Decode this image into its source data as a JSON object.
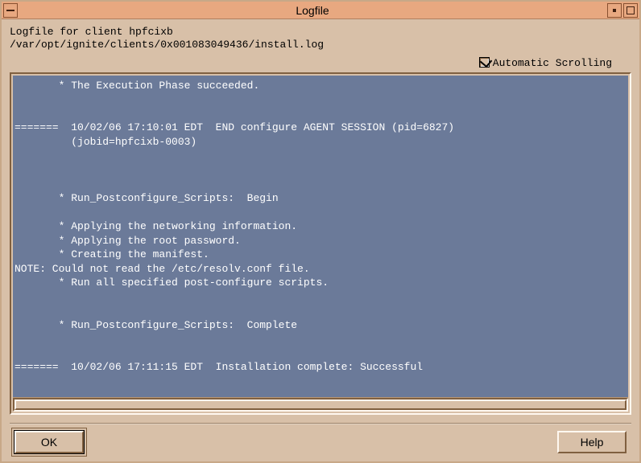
{
  "window": {
    "title": "Logfile"
  },
  "header": {
    "line1": "Logfile for client hpfcixb",
    "line2": "/var/opt/ignite/clients/0x001083049436/install.log"
  },
  "autoscroll": {
    "label": "Automatic Scrolling",
    "checked": true
  },
  "log": {
    "text": "       * The Execution Phase succeeded.\n\n\n=======  10/02/06 17:10:01 EDT  END configure AGENT SESSION (pid=6827)\n         (jobid=hpfcixb-0003)\n\n\n\n       * Run_Postconfigure_Scripts:  Begin\n\n       * Applying the networking information.\n       * Applying the root password.\n       * Creating the manifest.\nNOTE: Could not read the /etc/resolv.conf file.\n       * Run all specified post-configure scripts.\n\n\n       * Run_Postconfigure_Scripts:  Complete\n\n\n=======  10/02/06 17:11:15 EDT  Installation complete: Successful"
  },
  "buttons": {
    "ok": "OK",
    "help": "Help"
  }
}
